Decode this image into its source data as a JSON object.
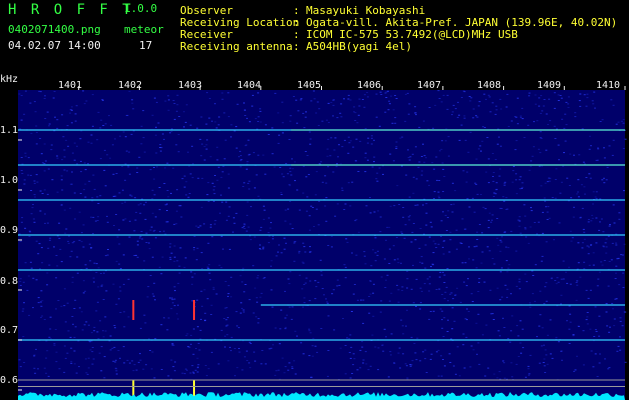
{
  "header": {
    "app_name": "H R O F F T",
    "version": "1.0.0",
    "filename": "0402071400.png",
    "datetime": "04.02.07 14:00",
    "meteor_label": "meteor",
    "meteor_count": "17",
    "info_labels": [
      "Observer",
      "Receiving Location",
      "Receiver",
      "Receiving antenna"
    ],
    "info_sep": ":",
    "info_values": [
      "Masayuki Kobayashi",
      "Ogata-vill. Akita-Pref. JAPAN (139.96E, 40.02N)",
      "ICOM IC-575 53.7492(@LCD)MHz USB",
      "A504HB(yagi 4el)"
    ]
  },
  "chart_data": {
    "type": "heatmap",
    "ylabel": "kHz",
    "y_ticks": [
      "1.1",
      "1.0",
      "0.9",
      "0.8",
      "0.7",
      "0.6"
    ],
    "x_ticks": [
      "1401",
      "1402",
      "1403",
      "1404",
      "1405",
      "1406",
      "1407",
      "1408",
      "1409",
      "1410"
    ],
    "ylim": [
      0.58,
      1.2
    ],
    "x_range_minutes": [
      1400,
      1410
    ],
    "grid": true,
    "carrier_lines_khz": [
      1.12,
      1.05,
      0.98,
      0.91,
      0.84,
      0.77,
      0.7
    ],
    "meteor_echo_times": [
      "1401.9",
      "1402.9"
    ],
    "colors": {
      "background": "#00006a",
      "noise_high": "#2a3cff",
      "line": "#33ccff",
      "peak": "#ffff33",
      "hot": "#ff3333",
      "baseline": "#00e8ff"
    }
  }
}
